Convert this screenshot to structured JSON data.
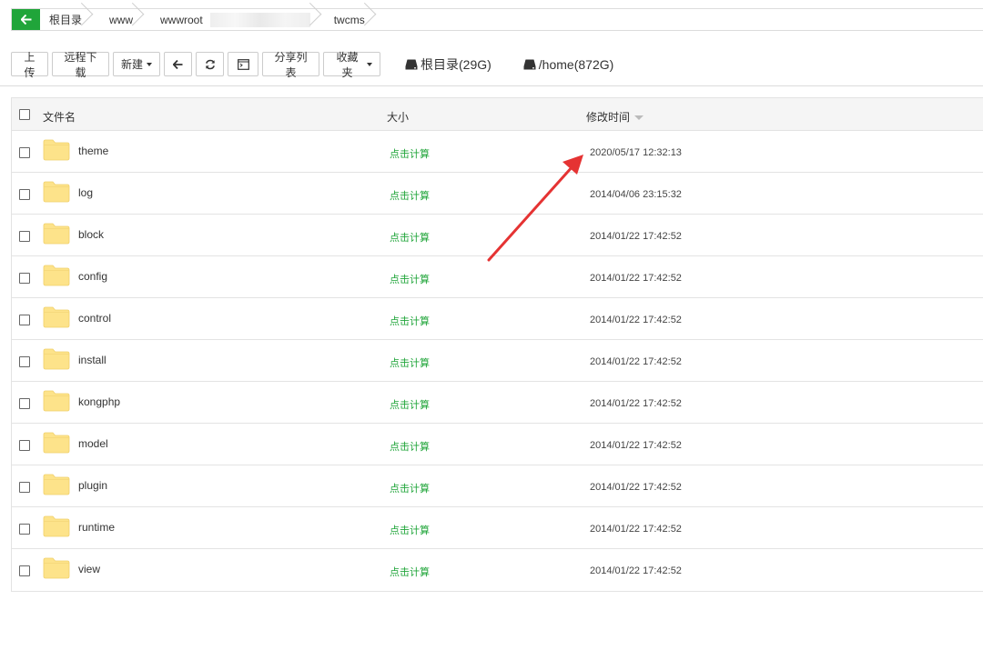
{
  "breadcrumb": {
    "items": [
      "根目录",
      "www",
      "wwwroot",
      "twcms"
    ],
    "accent": "#20a53a"
  },
  "toolbar": {
    "upload": "上传",
    "remote_download": "远程下载",
    "new": "新建",
    "share_list": "分享列表",
    "favorites": "收藏夹",
    "disk_root": "根目录(29G)",
    "disk_home": "/home(872G)"
  },
  "table": {
    "headers": {
      "name": "文件名",
      "size": "大小",
      "mtime": "修改时间"
    },
    "rows": [
      {
        "name": "theme",
        "size": "点击计算",
        "mtime": "2020/05/17 12:32:13"
      },
      {
        "name": "log",
        "size": "点击计算",
        "mtime": "2014/04/06 23:15:32"
      },
      {
        "name": "block",
        "size": "点击计算",
        "mtime": "2014/01/22 17:42:52"
      },
      {
        "name": "config",
        "size": "点击计算",
        "mtime": "2014/01/22 17:42:52"
      },
      {
        "name": "control",
        "size": "点击计算",
        "mtime": "2014/01/22 17:42:52"
      },
      {
        "name": "install",
        "size": "点击计算",
        "mtime": "2014/01/22 17:42:52"
      },
      {
        "name": "kongphp",
        "size": "点击计算",
        "mtime": "2014/01/22 17:42:52"
      },
      {
        "name": "model",
        "size": "点击计算",
        "mtime": "2014/01/22 17:42:52"
      },
      {
        "name": "plugin",
        "size": "点击计算",
        "mtime": "2014/01/22 17:42:52"
      },
      {
        "name": "runtime",
        "size": "点击计算",
        "mtime": "2014/01/22 17:42:52"
      },
      {
        "name": "view",
        "size": "点击计算",
        "mtime": "2014/01/22 17:42:52"
      }
    ]
  },
  "colors": {
    "size_link": "#20a53a",
    "annotation_arrow": "#e53333",
    "folder": "#fde38a"
  }
}
